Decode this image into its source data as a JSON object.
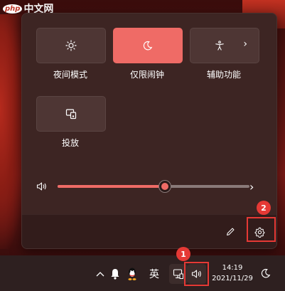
{
  "watermark": {
    "logo": "php",
    "name": "中文网"
  },
  "quick_settings": {
    "tiles": [
      {
        "label": "夜间模式",
        "icon": "brightness-icon",
        "active": false
      },
      {
        "label": "仅限闹钟",
        "icon": "moon-icon",
        "active": true
      },
      {
        "label": "辅助功能",
        "icon": "accessibility-icon",
        "active": false,
        "has_arrow": true
      },
      {
        "label": "投放",
        "icon": "cast-icon",
        "active": false
      }
    ],
    "volume": {
      "level": 0.56,
      "icon": "speaker-icon"
    },
    "footer": {
      "edit_icon": "pencil-icon",
      "settings_icon": "gear-icon"
    },
    "accent_color": "#ef6b66"
  },
  "taskbar": {
    "chevron": "^",
    "ime_label": "英",
    "time": "14:19",
    "date": "2021/11/29",
    "icons": [
      "chevron-up-icon",
      "bell-icon",
      "qq-icon",
      "network-icon",
      "speaker-icon",
      "moon-icon"
    ]
  },
  "annotations": [
    {
      "label": "1",
      "target": "taskbar-speaker"
    },
    {
      "label": "2",
      "target": "settings-gear"
    }
  ],
  "annotation_color": "#e53935"
}
